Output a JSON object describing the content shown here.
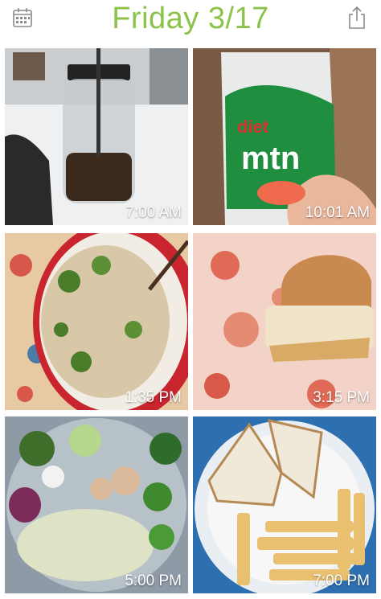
{
  "header": {
    "title": "Friday 3/17",
    "left_icon": "calendar-icon",
    "right_icon": "share-icon",
    "accent_color": "#8bc34a"
  },
  "photos": [
    {
      "time": "7:00 AM",
      "subject": "iced coffee jar"
    },
    {
      "time": "10:01 AM",
      "subject": "diet mountain dew can"
    },
    {
      "time": "1:35 PM",
      "subject": "rice with broccoli and chicken"
    },
    {
      "time": "3:15 PM",
      "subject": "slider sandwich"
    },
    {
      "time": "5:00 PM",
      "subject": "salad"
    },
    {
      "time": "7:00 PM",
      "subject": "sandwich and fries"
    }
  ]
}
